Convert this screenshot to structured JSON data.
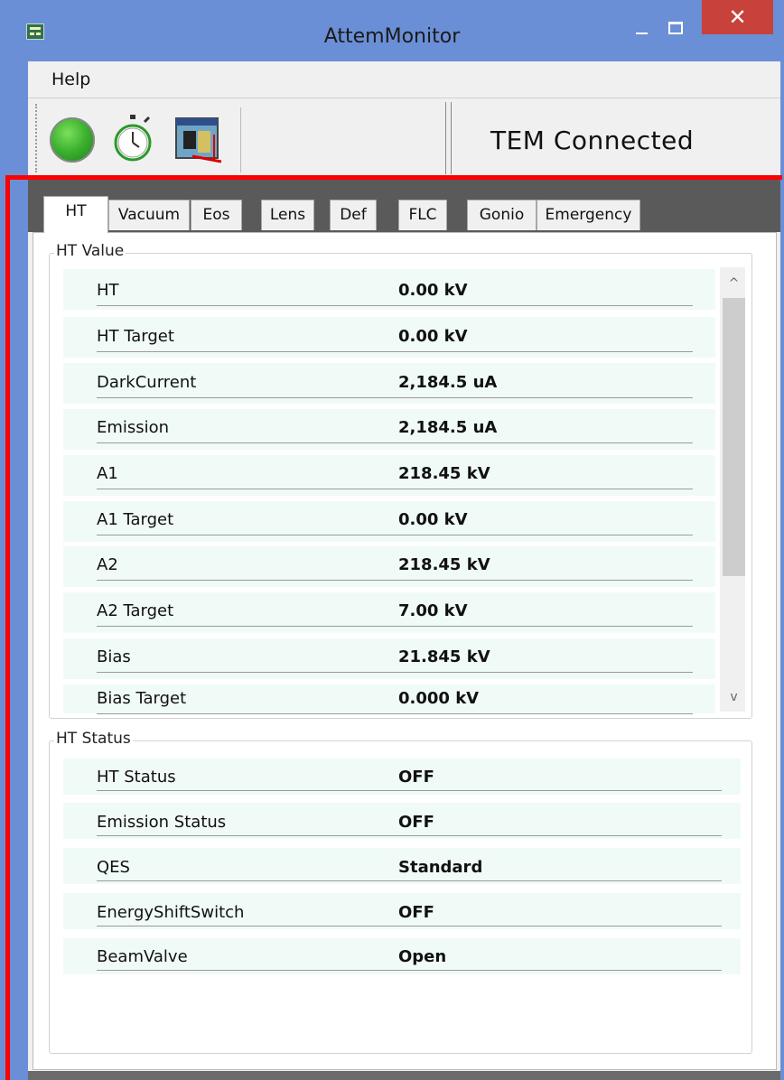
{
  "window": {
    "title": "AttemMonitor",
    "close_glyph": "✕",
    "accent": "#6b8fd6",
    "highlight": "#ff0000"
  },
  "menu": {
    "items": [
      {
        "label": "Help"
      }
    ]
  },
  "toolbar": {
    "icons": [
      "green-status-icon",
      "stopwatch-icon",
      "tool-window-icon"
    ],
    "status": "TEM Connected"
  },
  "tabs": [
    {
      "label": "HT",
      "active": true
    },
    {
      "label": "Vacuum"
    },
    {
      "label": "Eos"
    },
    {
      "label": "Lens"
    },
    {
      "label": "Def"
    },
    {
      "label": "FLC"
    },
    {
      "label": "Gonio"
    },
    {
      "label": "Emergency"
    }
  ],
  "ht_value": {
    "title": "HT Value",
    "rows": [
      {
        "label": "HT",
        "value": "0.00 kV"
      },
      {
        "label": "HT Target",
        "value": "0.00 kV"
      },
      {
        "label": "DarkCurrent",
        "value": "2,184.5 uA"
      },
      {
        "label": "Emission",
        "value": "2,184.5 uA"
      },
      {
        "label": "A1",
        "value": "218.45 kV"
      },
      {
        "label": "A1 Target",
        "value": "0.00 kV"
      },
      {
        "label": "A2",
        "value": "218.45 kV"
      },
      {
        "label": "A2 Target",
        "value": "7.00 kV"
      },
      {
        "label": "Bias",
        "value": "21.845 kV"
      },
      {
        "label": "Bias Target",
        "value": "0.000 kV"
      }
    ]
  },
  "ht_status": {
    "title": "HT Status",
    "rows": [
      {
        "label": "HT Status",
        "value": "OFF"
      },
      {
        "label": "Emission Status",
        "value": "OFF"
      },
      {
        "label": "QES",
        "value": "Standard"
      },
      {
        "label": "EnergyShiftSwitch",
        "value": "OFF"
      },
      {
        "label": "BeamValve",
        "value": "Open"
      }
    ]
  },
  "scrollbar": {
    "up_glyph": "^",
    "down_glyph": "v"
  }
}
